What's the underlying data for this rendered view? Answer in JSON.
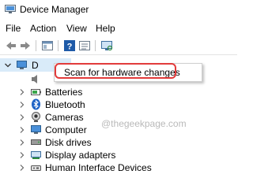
{
  "window": {
    "title": "Device Manager",
    "app_icon": "device-manager-icon"
  },
  "menu": {
    "items": [
      "File",
      "Action",
      "View",
      "Help"
    ]
  },
  "toolbar": {
    "buttons": [
      "back-arrow-icon",
      "forward-arrow-icon",
      "properties-icon",
      "help-icon",
      "view-icon",
      "scan-monitor-icon"
    ]
  },
  "tree": {
    "root": {
      "label": "D",
      "icon": "computer-icon",
      "expanded": true
    },
    "nodes": [
      {
        "label": "",
        "icon": "audio-icon"
      },
      {
        "label": "Batteries",
        "icon": "battery-icon"
      },
      {
        "label": "Bluetooth",
        "icon": "bluetooth-icon"
      },
      {
        "label": "Cameras",
        "icon": "camera-icon"
      },
      {
        "label": "Computer",
        "icon": "computer-icon"
      },
      {
        "label": "Disk drives",
        "icon": "disk-drive-icon"
      },
      {
        "label": "Display adapters",
        "icon": "display-adapter-icon"
      },
      {
        "label": "Human Interface Devices",
        "icon": "hid-icon"
      }
    ]
  },
  "context_menu": {
    "item": "Scan for hardware changes"
  },
  "watermark": "@thegeekpage.com",
  "colors": {
    "highlight": "#e23b3b",
    "selection": "#d9ebf9"
  }
}
